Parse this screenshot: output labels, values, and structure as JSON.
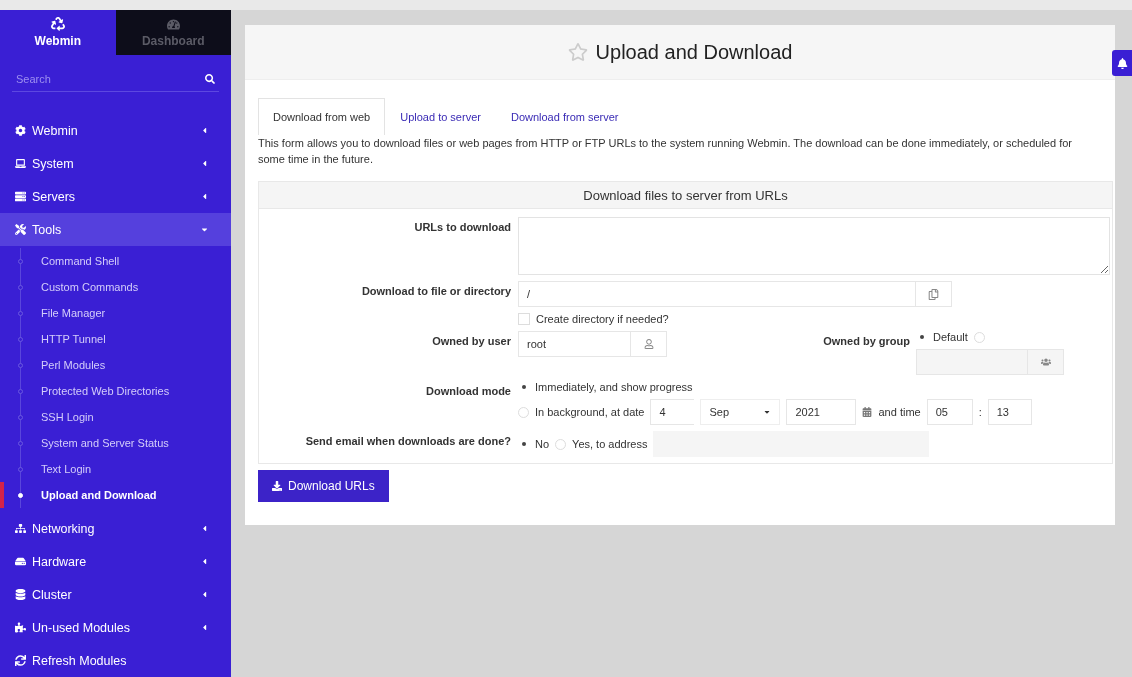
{
  "sidebar": {
    "tabs": [
      {
        "label": "Webmin",
        "kind": "logo",
        "selected": true
      },
      {
        "label": "Dashboard",
        "kind": "gauge",
        "selected": false
      }
    ],
    "search": {
      "placeholder": "Search"
    },
    "items": [
      {
        "label": "Webmin",
        "kind": "cog",
        "expanded": false
      },
      {
        "label": "System",
        "kind": "laptop",
        "expanded": false
      },
      {
        "label": "Servers",
        "kind": "server",
        "expanded": false
      },
      {
        "label": "Tools",
        "kind": "tools",
        "expanded": true,
        "children": [
          {
            "label": "Command Shell",
            "selected": false
          },
          {
            "label": "Custom Commands",
            "selected": false
          },
          {
            "label": "File Manager",
            "selected": false
          },
          {
            "label": "HTTP Tunnel",
            "selected": false
          },
          {
            "label": "Perl Modules",
            "selected": false
          },
          {
            "label": "Protected Web Directories",
            "selected": false
          },
          {
            "label": "SSH Login",
            "selected": false
          },
          {
            "label": "System and Server Status",
            "selected": false
          },
          {
            "label": "Text Login",
            "selected": false
          },
          {
            "label": "Upload and Download",
            "selected": true
          }
        ]
      },
      {
        "label": "Networking",
        "kind": "sitemap",
        "expanded": false
      },
      {
        "label": "Hardware",
        "kind": "hdd",
        "expanded": false
      },
      {
        "label": "Cluster",
        "kind": "database",
        "expanded": false
      },
      {
        "label": "Un-used Modules",
        "kind": "puzzle",
        "expanded": false
      },
      {
        "label": "Refresh Modules",
        "kind": "refresh"
      }
    ]
  },
  "page": {
    "title": "Upload and Download",
    "favorite": false
  },
  "tabs": [
    {
      "label": "Download from web",
      "selected": true
    },
    {
      "label": "Upload to server",
      "selected": false
    },
    {
      "label": "Download from server",
      "selected": false
    }
  ],
  "description": "This form allows you to download files or web pages from HTTP or FTP URLs to the system running Webmin. The download can be done immediately, or scheduled for some time in the future.",
  "form": {
    "title": "Download files to server from URLs",
    "urls": {
      "label": "URLs to download"
    },
    "destination": {
      "label": "Download to file or directory",
      "value": "/"
    },
    "create_directory": {
      "label": "Create directory if needed?",
      "checked": false
    },
    "owner": {
      "label": "Owned by user",
      "value": "root"
    },
    "group": {
      "label": "Owned by group",
      "default_option": {
        "label": "Default",
        "selected": true
      },
      "custom_selected": false
    },
    "mode": {
      "label": "Download mode",
      "options": [
        {
          "label": "Immediately, and show progress",
          "selected": true
        },
        {
          "label": "In background, at date",
          "selected": false
        }
      ],
      "day": "4",
      "month": "Sep",
      "year": "2021",
      "time_label": "and time",
      "hour": "05",
      "separator": ":",
      "minute": "13"
    },
    "email": {
      "label": "Send email when downloads are done?",
      "options": [
        {
          "label": "No",
          "selected": true
        },
        {
          "label": "Yes, to address",
          "selected": false
        }
      ]
    },
    "submit": "Download URLs"
  }
}
